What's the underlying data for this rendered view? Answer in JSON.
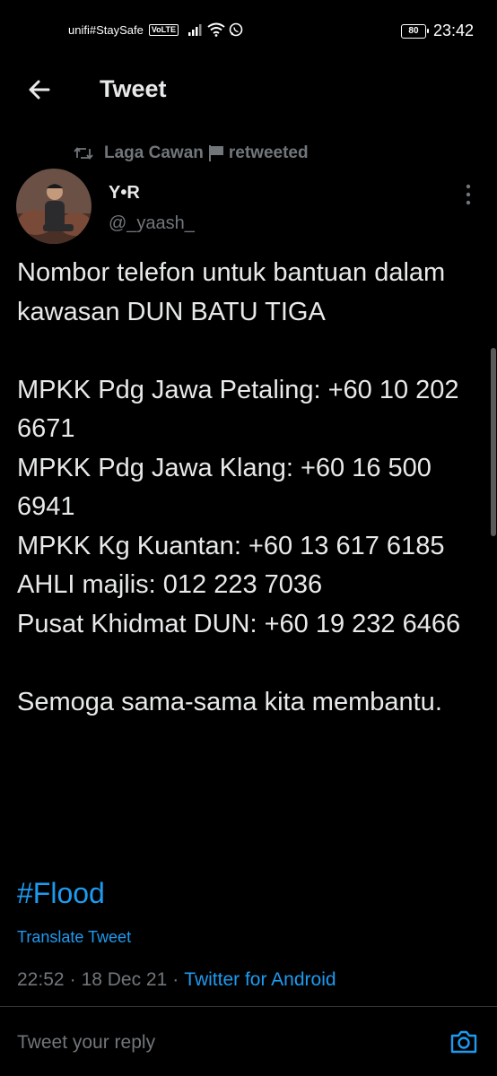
{
  "status_bar": {
    "carrier": "unifi#StaySafe",
    "volte": "VoLTE",
    "battery": "80",
    "time": "23:42"
  },
  "header": {
    "title": "Tweet",
    "back_icon": "arrow-left-icon"
  },
  "retweet": {
    "icon": "retweet-icon",
    "name": "Laga Cawan",
    "flag_icon": "flag-icon",
    "label": "retweeted"
  },
  "author": {
    "name": "Y•R",
    "handle": "@_yaash_"
  },
  "tweet": {
    "text": "Nombor telefon untuk bantuan dalam kawasan DUN BATU TIGA\n\nMPKK Pdg Jawa Petaling: +60 10 202 6671\nMPKK Pdg Jawa Klang: +60 16 500 6941\nMPKK Kg Kuantan: +60 13 617 6185\nAHLI majlis: 012 223 7036\nPusat Khidmat DUN: +60 19 232 6466\n\nSemoga sama-sama kita membantu.",
    "hashtag": "#Flood",
    "translate_label": "Translate Tweet",
    "time": "22:52",
    "sep1": "·",
    "date": "18 Dec 21",
    "sep2": "·",
    "source": "Twitter for Android"
  },
  "reply": {
    "placeholder": "Tweet your reply",
    "camera_icon": "camera-icon"
  },
  "colors": {
    "background": "#000000",
    "text": "#e7e9ea",
    "secondary": "#71767b",
    "accent": "#1d9bf0"
  }
}
